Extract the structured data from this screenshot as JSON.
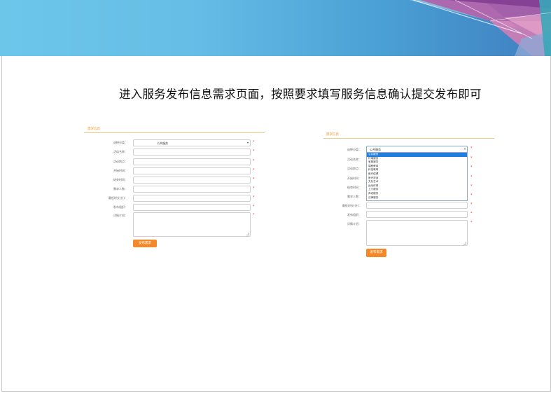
{
  "heading": "进入服务发布信息需求页面，按照要求填写服务信息确认提交发布即可",
  "form_left": {
    "section_title": "需求信息",
    "labels": [
      "选择分类：",
      "活动名称：",
      "活动地点：",
      "开始时间：",
      "结束时间：",
      "需求人数：",
      "最低时长(分)：",
      "发布组织：",
      "详情介绍："
    ],
    "category_value": "公共服务",
    "submit_label": "发布需求"
  },
  "form_right": {
    "section_title": "需求信息",
    "labels": [
      "选择分类：",
      "活动名称：",
      "活动地点：",
      "开始时间：",
      "结束时间：",
      "需求人数：",
      "最低时长(分)：",
      "发布组织：",
      "详情介绍："
    ],
    "category_value": "公共服务",
    "dropdown_options": [
      "公共服务",
      "环境服务",
      "家庭服务",
      "课程教育",
      "科技教育",
      "医疗保健",
      "医疗咨询",
      "文化艺术",
      "运动体育",
      "上门服务",
      "养老服务",
      "法律服务"
    ],
    "selected_option": "公共服务",
    "submit_label": "发布需求"
  },
  "colors": {
    "accent": "#f5892a",
    "section_title": "#f39a2e",
    "required": "#ee3333",
    "highlight": "#1e7fe0"
  }
}
